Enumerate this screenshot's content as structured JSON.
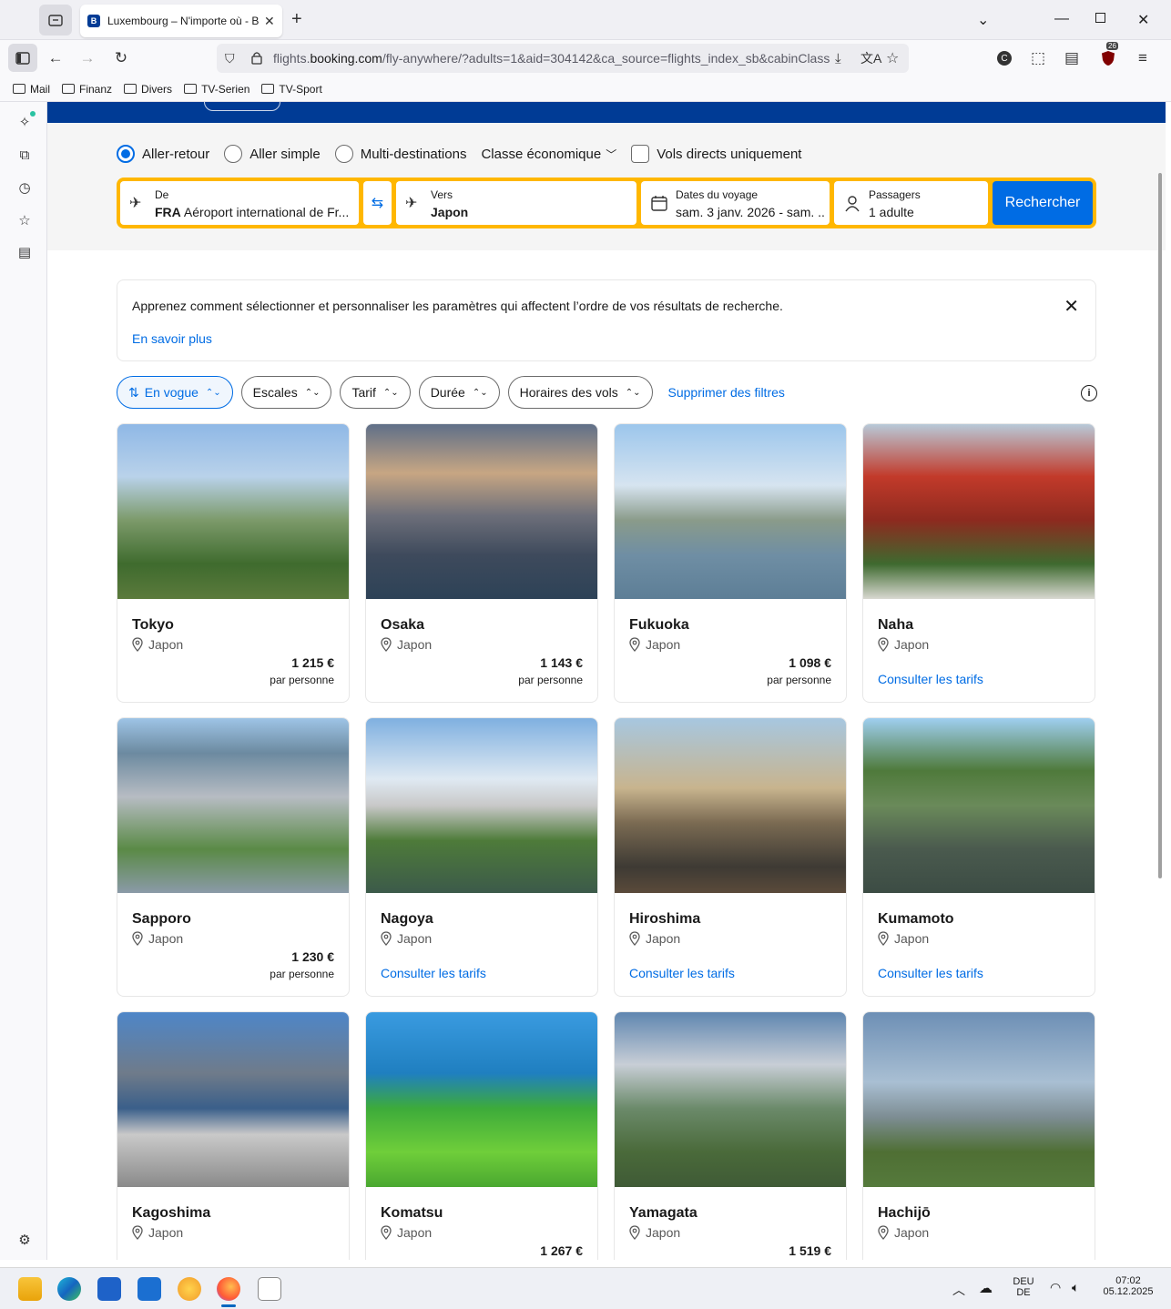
{
  "browser": {
    "tab_title": "Luxembourg – N'importe où - B",
    "url_prefix": "flights.",
    "url_domain": "booking.com",
    "url_rest": "/fly-anywhere/?adults=1&aid=304142&ca_source=flights_index_sb&cabinClass=",
    "extension_badge": "26"
  },
  "bookmarks": [
    "Mail",
    "Finanz",
    "Divers",
    "TV-Serien",
    "TV-Sport"
  ],
  "trip_type": {
    "options": [
      "Aller-retour",
      "Aller simple",
      "Multi-destinations"
    ],
    "selected": "Aller-retour",
    "cabin_class": "Classe économique",
    "direct_only_label": "Vols directs uniquement"
  },
  "search": {
    "from_label": "De",
    "from_code": "FRA",
    "from_value": "Aéroport international de Fr...",
    "to_label": "Vers",
    "to_value": "Japon",
    "dates_label": "Dates du voyage",
    "dates_value": "sam. 3 janv. 2026 - sam. ...",
    "passengers_label": "Passagers",
    "passengers_value": "1 adulte",
    "button": "Rechercher"
  },
  "info_banner": {
    "text": "Apprenez comment sélectionner et personnaliser les paramètres qui affectent l’ordre de vos résultats de recherche.",
    "link": "En savoir plus"
  },
  "filters": {
    "chips": [
      "En vogue",
      "Escales",
      "Tarif",
      "Durée",
      "Horaires des vols"
    ],
    "clear": "Supprimer des filtres"
  },
  "destinations": [
    {
      "city": "Tokyo",
      "country": "Japon",
      "price": "1 215 €",
      "per": "par personne",
      "link": ""
    },
    {
      "city": "Osaka",
      "country": "Japon",
      "price": "1 143 €",
      "per": "par personne",
      "link": ""
    },
    {
      "city": "Fukuoka",
      "country": "Japon",
      "price": "1 098 €",
      "per": "par personne",
      "link": ""
    },
    {
      "city": "Naha",
      "country": "Japon",
      "price": "",
      "per": "",
      "link": "Consulter les tarifs"
    },
    {
      "city": "Sapporo",
      "country": "Japon",
      "price": "1 230 €",
      "per": "par personne",
      "link": ""
    },
    {
      "city": "Nagoya",
      "country": "Japon",
      "price": "",
      "per": "",
      "link": "Consulter les tarifs"
    },
    {
      "city": "Hiroshima",
      "country": "Japon",
      "price": "",
      "per": "",
      "link": "Consulter les tarifs"
    },
    {
      "city": "Kumamoto",
      "country": "Japon",
      "price": "",
      "per": "",
      "link": "Consulter les tarifs"
    },
    {
      "city": "Kagoshima",
      "country": "Japon",
      "price": "",
      "per": "",
      "link": ""
    },
    {
      "city": "Komatsu",
      "country": "Japon",
      "price": "1 267 €",
      "per": "",
      "link": ""
    },
    {
      "city": "Yamagata",
      "country": "Japon",
      "price": "1 519 €",
      "per": "",
      "link": ""
    },
    {
      "city": "Hachijō",
      "country": "Japon",
      "price": "",
      "per": "",
      "link": ""
    }
  ],
  "taskbar": {
    "lang_top": "DEU",
    "lang_bottom": "DE",
    "time": "07:02",
    "date": "05.12.2025"
  }
}
